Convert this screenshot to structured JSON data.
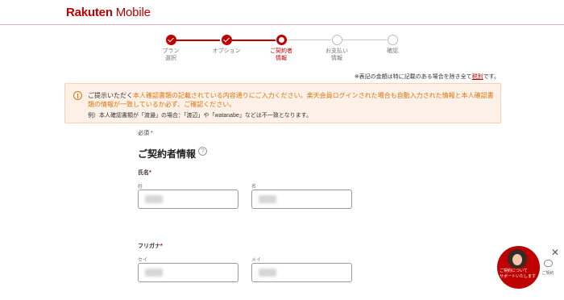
{
  "header": {
    "brand": "Rakuten",
    "product": " Mobile"
  },
  "steps": [
    {
      "label": "プラン\n選択",
      "state": "done"
    },
    {
      "label": "オプション",
      "state": "done"
    },
    {
      "label": "ご契約者\n情報",
      "state": "current"
    },
    {
      "label": "お支払い\n情報",
      "state": "todo"
    },
    {
      "label": "確認",
      "state": "todo"
    }
  ],
  "note": {
    "text": "※表記の金額は特に記載のある場合を除き全て",
    "link": "税別",
    "suffix": "です。"
  },
  "alert": {
    "lead": "ご提示いただく",
    "highlight": "本人確認書類の記載されている内容通りにご入力ください。楽天会員ログインされた場合も自動入力された情報と本人確認書類の情報が一致しているか必ず、ご確認ください。",
    "example": "例）本人確認書類が「渡邉」の場合：「渡辺」や「watanabe」などは不一致となります。"
  },
  "form": {
    "required_label": "必須",
    "required_mark": "*",
    "section_title": "ご契約者情報",
    "help": "?",
    "name_label": "氏名",
    "last_name_label": "姓",
    "first_name_label": "名",
    "kana_label": "フリガナ",
    "last_kana_label": "セイ",
    "first_kana_label": "メイ"
  },
  "chat": {
    "bubble_text": "ご契約について\nサポートいたします",
    "close": "✕",
    "side_label": "ご契約"
  },
  "colors": {
    "accent": "#bf0000",
    "alert_text": "#e0760f",
    "alert_bg": "#fdf0e6"
  }
}
